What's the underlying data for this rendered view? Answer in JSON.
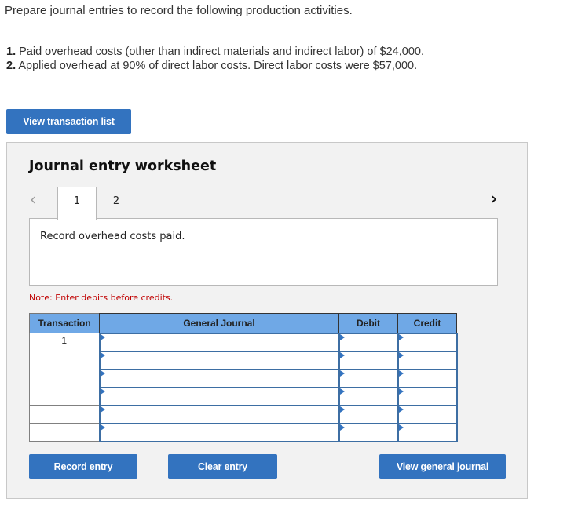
{
  "intro": "Prepare journal entries to record the following production activities.",
  "items": [
    {
      "num": "1.",
      "text": "Paid overhead costs (other than indirect materials and indirect labor) of $24,000."
    },
    {
      "num": "2.",
      "text": "Applied overhead at 90% of direct labor costs. Direct labor costs were $57,000."
    }
  ],
  "buttons": {
    "view_transaction_list": "View transaction list",
    "record_entry": "Record entry",
    "clear_entry": "Clear entry",
    "view_general_journal": "View general journal"
  },
  "worksheet": {
    "title": "Journal entry worksheet",
    "prev_icon": "chevron-left-icon",
    "next_icon": "chevron-right-icon",
    "tabs": [
      {
        "label": "1",
        "active": true
      },
      {
        "label": "2",
        "active": false
      }
    ],
    "description": "Record overhead costs paid.",
    "note": "Note: Enter debits before credits."
  },
  "table": {
    "headers": [
      "Transaction",
      "General Journal",
      "Debit",
      "Credit"
    ],
    "rows": [
      {
        "transaction": "1",
        "account": "",
        "debit": "",
        "credit": ""
      },
      {
        "transaction": "",
        "account": "",
        "debit": "",
        "credit": ""
      },
      {
        "transaction": "",
        "account": "",
        "debit": "",
        "credit": ""
      },
      {
        "transaction": "",
        "account": "",
        "debit": "",
        "credit": ""
      },
      {
        "transaction": "",
        "account": "",
        "debit": "",
        "credit": ""
      },
      {
        "transaction": "",
        "account": "",
        "debit": "",
        "credit": ""
      }
    ]
  },
  "colors": {
    "button": "#3373bf",
    "header": "#6fa8e6",
    "note": "#c00000",
    "input_border": "#3d6ea3"
  }
}
